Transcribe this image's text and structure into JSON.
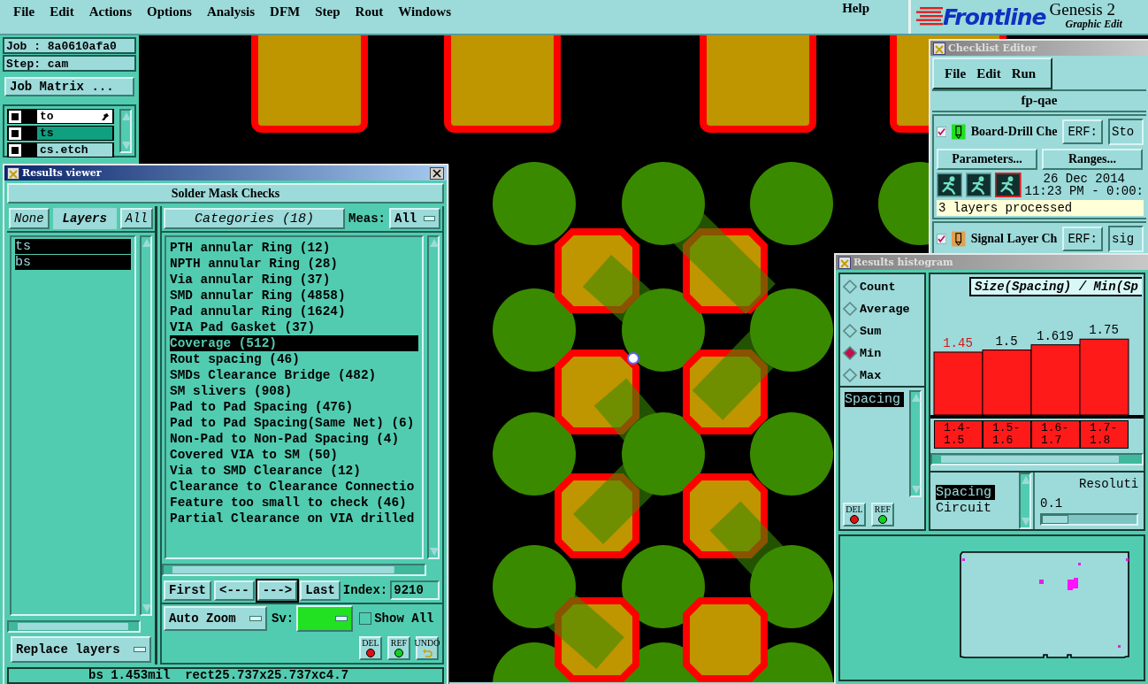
{
  "menubar": {
    "items": [
      "File",
      "Edit",
      "Actions",
      "Options",
      "Analysis",
      "DFM",
      "Step",
      "Rout",
      "Windows"
    ],
    "help": "Help"
  },
  "logo": {
    "brand": "Frontline",
    "title": "Genesis 2",
    "subtitle": "Graphic Edit"
  },
  "job_panel": {
    "job": "Job : 8a0610afa0",
    "step": "Step: cam",
    "matrix_button": "Job Matrix ...",
    "layers": [
      {
        "name": "to",
        "kind": "work",
        "displayed": false
      },
      {
        "name": "ts",
        "kind": "affected",
        "displayed": false
      },
      {
        "name": "cs.etch",
        "kind": "plain",
        "displayed": false
      }
    ]
  },
  "results_viewer": {
    "title": "Results viewer",
    "header": "Solder Mask Checks",
    "layer_buttons": [
      {
        "label": "None",
        "kind": "button"
      },
      {
        "label": "Layers",
        "kind": "label"
      },
      {
        "label": "All",
        "kind": "button"
      }
    ],
    "layers": [
      {
        "name": "ts",
        "selected": true
      },
      {
        "name": "bs",
        "selected": true
      }
    ],
    "categories_button": "Categories (18)",
    "meas_label": "Meas:",
    "meas_value": "All",
    "categories": [
      {
        "name": "PTH annular Ring (12)",
        "selected": false
      },
      {
        "name": "NPTH annular Ring (28)",
        "selected": false
      },
      {
        "name": "Via annular Ring (37)",
        "selected": false
      },
      {
        "name": "SMD annular Ring (4858)",
        "selected": false
      },
      {
        "name": "Pad annular Ring (1624)",
        "selected": false
      },
      {
        "name": "VIA Pad Gasket (37)",
        "selected": false
      },
      {
        "name": "Coverage (512)",
        "selected": true
      },
      {
        "name": "Rout spacing (46)",
        "selected": false
      },
      {
        "name": "SMDs Clearance Bridge (482)",
        "selected": false
      },
      {
        "name": "SM slivers (908)",
        "selected": false
      },
      {
        "name": "Pad to Pad Spacing (476)",
        "selected": false
      },
      {
        "name": "Pad to Pad Spacing(Same Net) (6)",
        "selected": false
      },
      {
        "name": "Non-Pad to Non-Pad Spacing (4)",
        "selected": false
      },
      {
        "name": "Covered VIA to SM (50)",
        "selected": false
      },
      {
        "name": "Via to SMD Clearance (12)",
        "selected": false
      },
      {
        "name": "Clearance to Clearance Connectio",
        "selected": false
      },
      {
        "name": "Feature too small to check (46)",
        "selected": false
      },
      {
        "name": "Partial Clearance on VIA drilled",
        "selected": false
      }
    ],
    "nav_buttons": [
      {
        "label": "First",
        "selected": false
      },
      {
        "label": "<---",
        "selected": false
      },
      {
        "label": "--->",
        "selected": true
      },
      {
        "label": "Last",
        "selected": false
      }
    ],
    "index_label": "Index:",
    "index_value": "9210",
    "zoom_value": "Auto Zoom",
    "sv_label": "Sv:",
    "show_all": {
      "label": "Show All",
      "checked": false
    },
    "replace_value": "Replace layers",
    "tool_buttons": [
      {
        "label": "DEL",
        "kind": "del"
      },
      {
        "label": "REF",
        "kind": "ref"
      },
      {
        "label": "UNDO",
        "kind": "undo"
      }
    ],
    "status": "bs 1.453mil  rect25.737x25.737xc4.7"
  },
  "checklist_editor": {
    "title": "Checklist Editor",
    "menu": [
      "File",
      "Edit",
      "Run"
    ],
    "checklist_name": "fp-qae",
    "checks": [
      {
        "name": "Board-Drill Che",
        "kind": "drill",
        "checked": true,
        "erf_label": "ERF:",
        "erf_value": "Sto",
        "buttons": [
          "Parameters...",
          "Ranges..."
        ],
        "date": "26 Dec 2014",
        "time": "11:23 PM - 0:00:",
        "status": "3 layers processed"
      },
      {
        "name": "Signal Layer Ch",
        "kind": "signal",
        "checked": true,
        "erf_label": "ERF:",
        "erf_value": "sig"
      }
    ]
  },
  "histogram": {
    "title": "Results histogram",
    "modes": [
      {
        "label": "Count",
        "selected": false
      },
      {
        "label": "Average",
        "selected": false
      },
      {
        "label": "Sum",
        "selected": false
      },
      {
        "label": "Min",
        "selected": true
      },
      {
        "label": "Max",
        "selected": false
      }
    ],
    "measures": [
      {
        "name": "Spacing",
        "selected": true
      }
    ],
    "chart_title": "Size(Spacing) / Min(Sp",
    "chart_data": {
      "type": "bar",
      "categories": [
        "1.4-1.5",
        "1.5-1.6",
        "1.6-1.7",
        "1.7-1.8"
      ],
      "values": [
        1.45,
        1.5,
        1.619,
        1.75
      ],
      "data_labels": true
    },
    "attributes": [
      {
        "name": "Spacing",
        "selected": true
      },
      {
        "name": "Circuit",
        "selected": false
      }
    ],
    "resolution_label": "Resoluti",
    "resolution_value": "0.1",
    "resolution_slider": {
      "level": 0.1
    },
    "tool_buttons": [
      {
        "label": "DEL",
        "kind": "del"
      },
      {
        "label": "REF",
        "kind": "ref"
      }
    ]
  }
}
